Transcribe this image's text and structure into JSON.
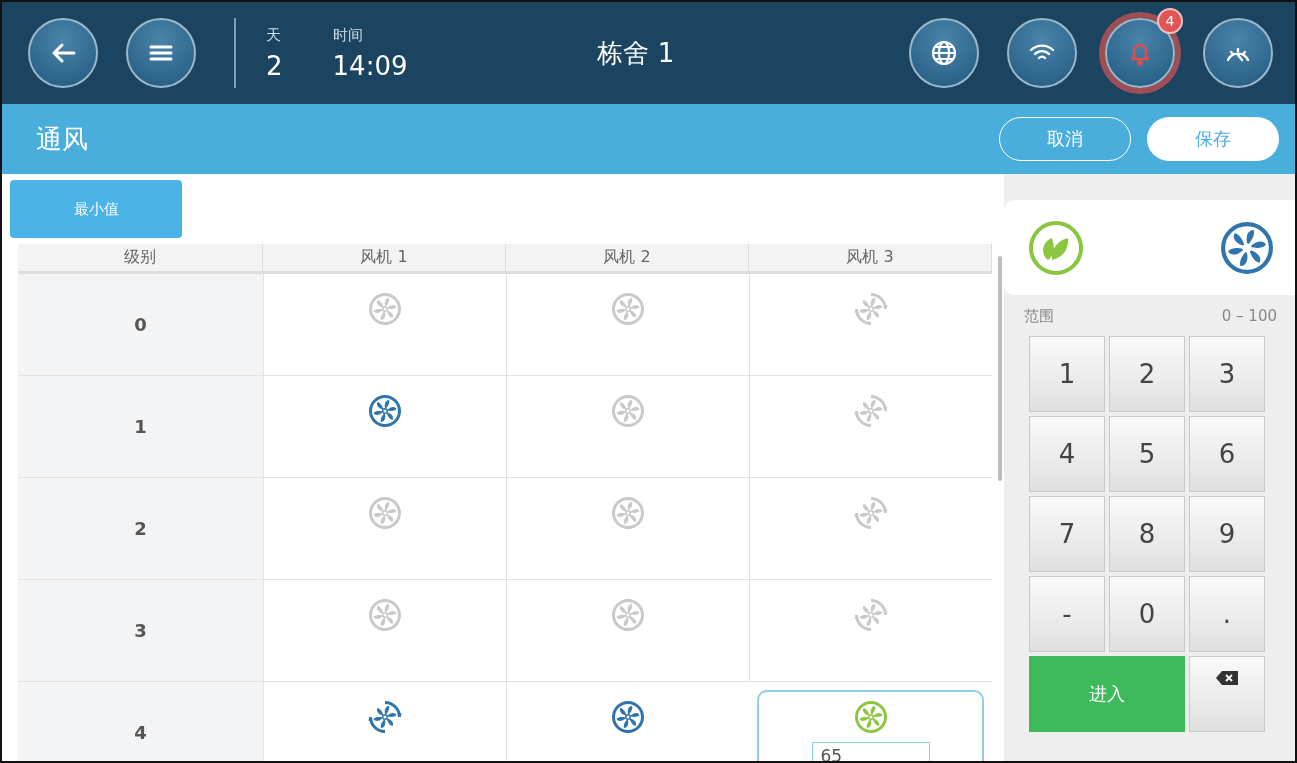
{
  "top_bar": {
    "day_label": "天",
    "day": "2",
    "time_label": "时间",
    "time": "14:09",
    "title": "栋舍 1",
    "alarm_count": "4",
    "alarm_active": true
  },
  "page": {
    "title": "通风",
    "buttons": [
      {
        "label": "取消",
        "kind": "outline"
      },
      {
        "label": "保存",
        "kind": "filled"
      }
    ]
  },
  "tab": {
    "label": "最小值",
    "selected": true
  },
  "table": {
    "columns": [
      "级别",
      "风机 1",
      "风机 2",
      "风机 3"
    ],
    "rows": [
      {
        "level": "0",
        "fans": [
          {
            "on": false,
            "selected": false,
            "variable": false
          },
          {
            "on": false,
            "selected": false,
            "variable": false
          },
          {
            "on": false,
            "selected": false,
            "variable": true
          }
        ]
      },
      {
        "level": "1",
        "fans": [
          {
            "on": true,
            "selected": false,
            "variable": false
          },
          {
            "on": false,
            "selected": false,
            "variable": false
          },
          {
            "on": false,
            "selected": false,
            "variable": true
          }
        ]
      },
      {
        "level": "2",
        "fans": [
          {
            "on": false,
            "selected": false,
            "variable": false
          },
          {
            "on": false,
            "selected": false,
            "variable": false
          },
          {
            "on": false,
            "selected": false,
            "variable": true
          }
        ]
      },
      {
        "level": "3",
        "fans": [
          {
            "on": false,
            "selected": false,
            "variable": false
          },
          {
            "on": false,
            "selected": false,
            "variable": false
          },
          {
            "on": false,
            "selected": false,
            "variable": true
          }
        ]
      },
      {
        "level": "4",
        "fans": [
          {
            "on": true,
            "selected": false,
            "variable": true
          },
          {
            "on": true,
            "selected": false,
            "variable": false
          },
          {
            "on": true,
            "selected": true,
            "variable": false,
            "value": "65"
          }
        ]
      }
    ]
  },
  "keypad": {
    "range_label": "范围",
    "range": "0 – 100",
    "keys": [
      {
        "label": "1",
        "kind": "digit"
      },
      {
        "label": "2",
        "kind": "digit"
      },
      {
        "label": "3",
        "kind": "digit"
      },
      {
        "label": "4",
        "kind": "digit"
      },
      {
        "label": "5",
        "kind": "digit"
      },
      {
        "label": "6",
        "kind": "digit"
      },
      {
        "label": "7",
        "kind": "digit"
      },
      {
        "label": "8",
        "kind": "digit"
      },
      {
        "label": "9",
        "kind": "digit"
      },
      {
        "label": "-",
        "kind": "digit"
      },
      {
        "label": "0",
        "kind": "digit"
      },
      {
        "label": ".",
        "kind": "digit"
      },
      {
        "label": "进入",
        "kind": "enter"
      },
      {
        "kind": "backspace"
      }
    ]
  }
}
